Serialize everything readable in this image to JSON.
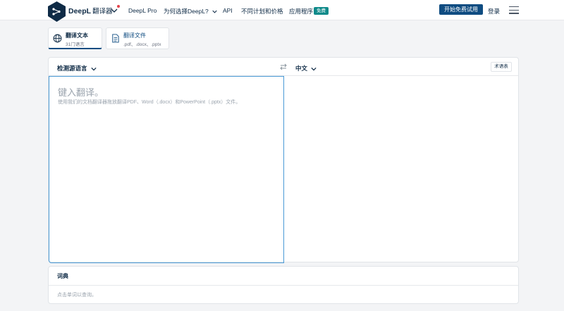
{
  "header": {
    "brand": "DeepL",
    "brand_sub": "翻译器",
    "nav": {
      "pro": "DeepL Pro",
      "why": "为何选择DeepL?",
      "api": "API",
      "plans": "不同计划和价格",
      "apps": "应用程序"
    },
    "apps_badge": "免费",
    "cta_label": "开始免费试用",
    "login_label": "登录",
    "colors": {
      "brand": "#0f2b46",
      "accent": "#0f4c81",
      "badge": "#0f8a8a",
      "dot": "#e4434b"
    }
  },
  "mode_tabs": [
    {
      "title": "翻译文本",
      "subtitle": "31门语言",
      "icon": "globe-icon"
    },
    {
      "title": "翻译文件",
      "subtitle": ".pdf、.docx、.pptx",
      "icon": "document-icon"
    }
  ],
  "translator": {
    "source_lang": "检测源语言",
    "target_lang": "中文",
    "glossary_label": "术语表",
    "placeholder": "键入翻译。",
    "hint": "使用我们的文档翻译器拖放翻译PDF、Word（.docx）和PowerPoint（.pptx）文件。"
  },
  "dictionary": {
    "title": "词典",
    "hint": "点击单词以查询。"
  }
}
